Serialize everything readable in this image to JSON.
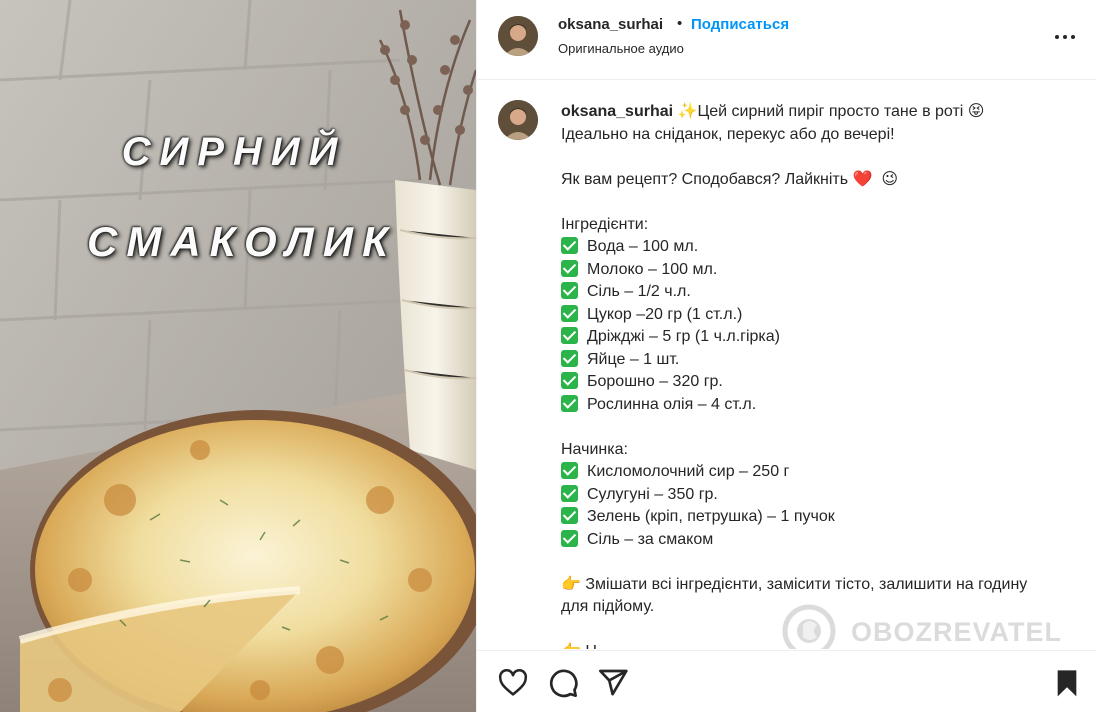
{
  "media": {
    "overlay_line1": "СИРНИЙ",
    "overlay_line2": "СМАКОЛИК"
  },
  "post": {
    "username": "oksana_surhai",
    "follow_label": "Подписаться",
    "separator": "•",
    "audio_label": "Оригинальное аудио",
    "more_icon": "more-options-icon"
  },
  "caption": {
    "username": "oksana_surhai",
    "intro": "✨Цей сирний пиріг просто тане в роті 😝\nІдеально на сніданок, перекус або до вечері!",
    "question": "Як вам рецепт? Сподобався? Лайкніть ❤️  😉",
    "ingredients_title": "Інгредієнти:",
    "ingredients": [
      "Вода – 100 мл.",
      "Молоко – 100 мл.",
      "Сіль – 1/2 ч.л.",
      "Цукор –20 гр (1 ст.л.)",
      "Дріжджі – 5 гр (1 ч.л.гірка)",
      "Яйце – 1 шт.",
      "Борошно – 320 гр.",
      "Рослинна олія – 4 ст.л."
    ],
    "filling_title": "Начинка:",
    "filling": [
      "Кисломолочний сир – 250 г",
      "Сулугуні – 350 гр.",
      "Зелень (кріп, петрушка) – 1 пучок",
      "Сіль – за смаком"
    ],
    "step1": "👉 Змішати всі інгредієнти, замісити тісто, залишити на годину для підйому.",
    "step2_partial": "👉 Н"
  },
  "watermark": {
    "text": "OBOZREVATEL"
  },
  "actions": {
    "like": "heart-icon",
    "comment": "comment-icon",
    "share": "paper-plane-icon",
    "save": "bookmark-icon"
  },
  "colors": {
    "link": "#0095f6",
    "checkbox": "#2bb44a",
    "heart": "#e0245e",
    "text": "#262626"
  }
}
